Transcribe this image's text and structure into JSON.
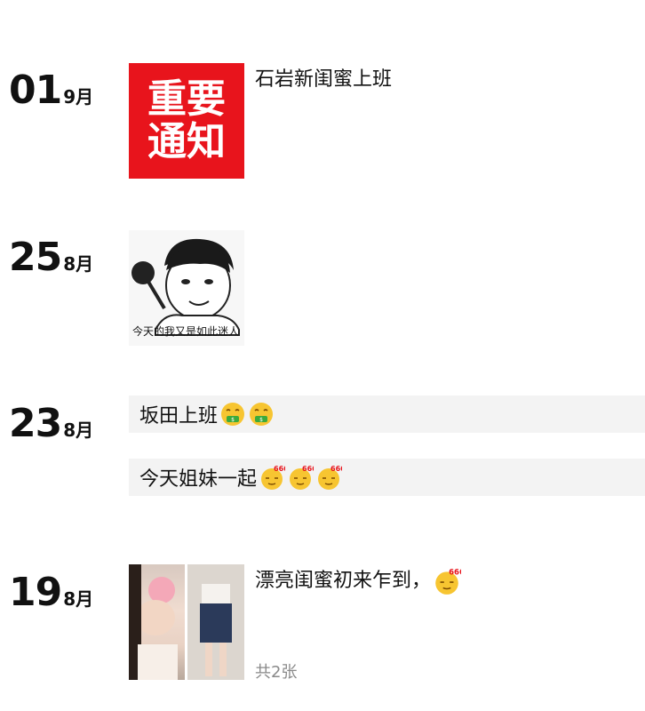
{
  "posts": [
    {
      "day": "01",
      "month": "9月",
      "caption": "石岩新闺蜜上班",
      "image": {
        "text_line1": "重要",
        "text_line2": "通知",
        "icon": "important-notice-poster"
      }
    },
    {
      "day": "25",
      "month": "8月",
      "image": {
        "caption": "今天的我又是如此迷人",
        "icon": "meme-cartoon-face"
      }
    },
    {
      "day": "23",
      "month": "8月",
      "texts": [
        {
          "text": "坂田上班",
          "emojis": [
            "money-mouth-emoji",
            "money-mouth-emoji"
          ]
        },
        {
          "text": "今天姐妹一起",
          "emojis": [
            "666-emoji",
            "666-emoji",
            "666-emoji"
          ]
        }
      ]
    },
    {
      "day": "19",
      "month": "8月",
      "caption": "漂亮闺蜜初来乍到，",
      "caption_emoji": "666-emoji",
      "photo_count": "共2张",
      "images": [
        "selfie-with-rose-photo",
        "denim-skirt-outfit-photo"
      ]
    }
  ],
  "colors": {
    "poster_red": "#e8141c",
    "text_bar_bg": "#f3f3f3",
    "muted_text": "#8a8a8a"
  }
}
